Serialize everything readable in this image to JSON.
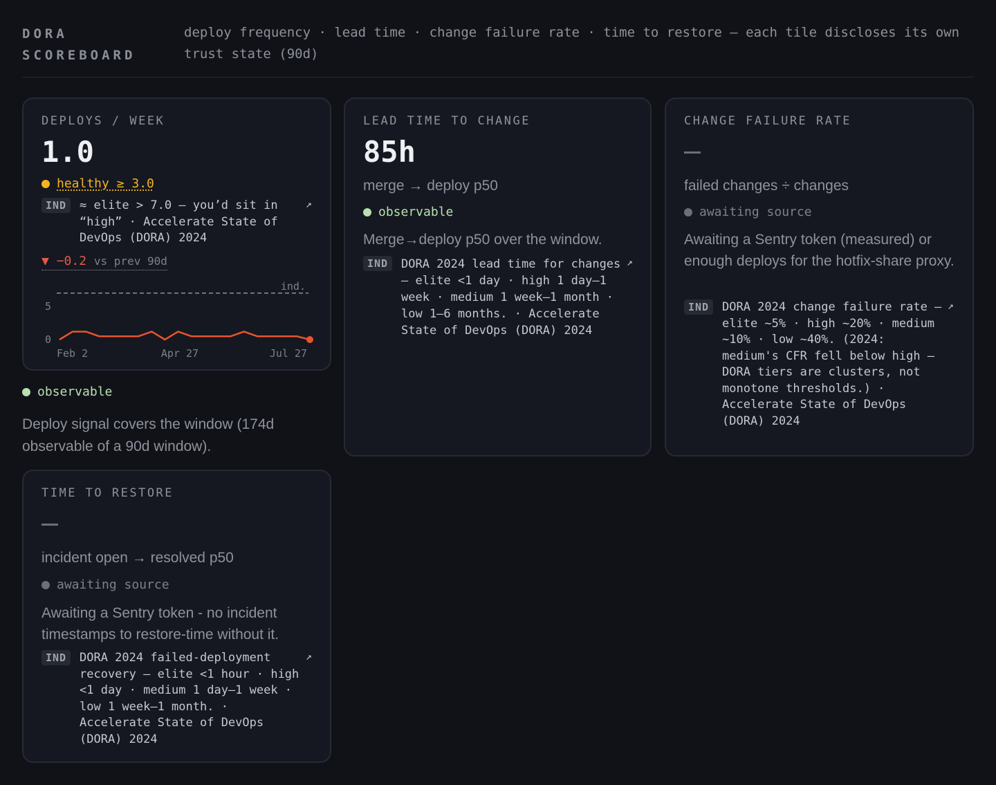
{
  "header": {
    "brand_line1": "DORA",
    "brand_line2": "SCOREBOARD",
    "tagline": "deploy frequency · lead time · change failure rate · time to restore — each tile discloses its own trust state (90d)"
  },
  "deploys": {
    "label": "DEPLOYS / WEEK",
    "value": "1.0",
    "healthy": "healthy ≥ 3.0",
    "ind_badge": "IND",
    "ind_text": "≈ elite > 7.0 — you’d sit in “high” · Accelerate State of DevOps (DORA) 2024",
    "ind_arrow": "↗",
    "delta_arrow": "▼",
    "delta_value": "−0.2",
    "delta_vs": "vs prev 90d",
    "status": "observable",
    "desc": "Deploy signal covers the window (174d observable of a 90d window)."
  },
  "chart_data": {
    "type": "line",
    "x_tick_labels": [
      "Feb 2",
      "Apr 27",
      "Jul 27"
    ],
    "y_tick_labels": [
      "5",
      "0"
    ],
    "ylim": [
      0,
      7.5
    ],
    "reference_line": {
      "label": "ind.",
      "value": 7.0
    },
    "series": [
      {
        "color": "#e8542f",
        "values": [
          0,
          1.2,
          1.2,
          0.5,
          0.5,
          0.5,
          0.5,
          1.2,
          0,
          1.2,
          0.5,
          0.5,
          0.5,
          0.5,
          1.2,
          0.5,
          0.5,
          0.5,
          0.5,
          0
        ]
      }
    ]
  },
  "lead_time": {
    "label": "LEAD TIME TO CHANGE",
    "value": "85h",
    "sub": "merge → deploy p50",
    "status": "observable",
    "desc": "Merge→deploy p50 over the window.",
    "ind_badge": "IND",
    "ind_text": "DORA 2024 lead time for changes — elite <1 day · high 1 day–1 week · medium 1 week–1 month · low 1–6 months. · Accelerate State of DevOps (DORA) 2024",
    "ind_arrow": "↗"
  },
  "cfr": {
    "label": "CHANGE FAILURE RATE",
    "sub": "failed changes ÷ changes",
    "status": "awaiting source",
    "desc": "Awaiting a Sentry token (measured) or enough deploys for the hotfix-share proxy.",
    "ind_badge": "IND",
    "ind_text": "DORA 2024 change failure rate — elite ~5% · high ~20% · medium ~10% · low ~40%. (2024: medium's CFR fell below high — DORA tiers are clusters, not monotone thresholds.) · Accelerate State of DevOps (DORA) 2024",
    "ind_arrow": "↗"
  },
  "restore": {
    "label": "TIME TO RESTORE",
    "sub": "incident open → resolved p50",
    "status": "awaiting source",
    "desc": "Awaiting a Sentry token - no incident timestamps to restore-time without it.",
    "ind_badge": "IND",
    "ind_text": "DORA 2024 failed-deployment recovery — elite <1 hour · high <1 day · medium 1 day–1 week · low 1 week–1 month. · Accelerate State of DevOps (DORA) 2024",
    "ind_arrow": "↗"
  },
  "colors": {
    "background": "#101218",
    "card": "#151820",
    "green": "#b8e0b0",
    "amber": "#f4b422",
    "red": "#e05a4a",
    "grey_dot": "#6a6f78"
  }
}
